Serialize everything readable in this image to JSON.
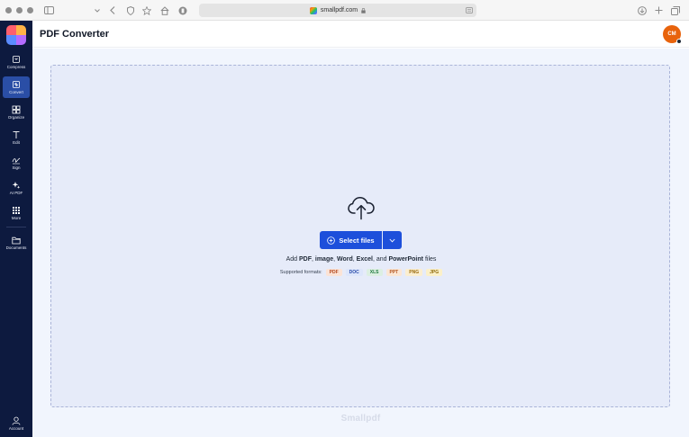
{
  "browser": {
    "url": "smallpdf.com"
  },
  "sidebar": {
    "items": [
      {
        "label": "Compress",
        "icon": "compress-icon"
      },
      {
        "label": "Convert",
        "icon": "convert-icon",
        "active": true
      },
      {
        "label": "Organize",
        "icon": "organize-icon"
      },
      {
        "label": "Edit",
        "icon": "edit-icon"
      },
      {
        "label": "Sign",
        "icon": "sign-icon"
      },
      {
        "label": "AI PDF",
        "icon": "ai-pdf-icon"
      },
      {
        "label": "More",
        "icon": "more-icon"
      }
    ],
    "documents_label": "Documents",
    "account_label": "Account"
  },
  "header": {
    "title": "PDF Converter",
    "avatar_initials": "CM"
  },
  "dropzone": {
    "select_label": "Select files",
    "add_prefix": "Add ",
    "add_pdf": "PDF",
    "sep1": ", ",
    "add_image": "image",
    "sep2": ", ",
    "add_word": "Word",
    "sep3": ", ",
    "add_excel": "Excel",
    "sep4": ", and ",
    "add_ppt": "PowerPoint",
    "add_suffix": " files",
    "supported_label": "Supported formats:",
    "formats": [
      {
        "label": "PDF",
        "bg": "#fbe3d6",
        "fg": "#b4471b"
      },
      {
        "label": "DOC",
        "bg": "#dde6fb",
        "fg": "#2749a8"
      },
      {
        "label": "XLS",
        "bg": "#dcefe2",
        "fg": "#1f7a3e"
      },
      {
        "label": "PPT",
        "bg": "#fbe6d4",
        "fg": "#b3541e"
      },
      {
        "label": "PNG",
        "bg": "#fbeed0",
        "fg": "#9a6b0e"
      },
      {
        "label": "JPG",
        "bg": "#fbf0c9",
        "fg": "#8f6a0b"
      }
    ]
  },
  "footer": {
    "brand": "Smallpdf"
  },
  "colors": {
    "sidebar_bg": "#0d1a3f",
    "accent": "#1d4fdb",
    "avatar": "#e8630c"
  }
}
